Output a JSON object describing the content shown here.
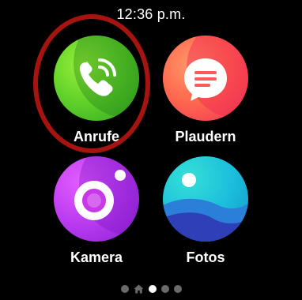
{
  "status": {
    "time": "12:36 p.m."
  },
  "apps": [
    {
      "label": "Anrufe",
      "icon": "phone-icon"
    },
    {
      "label": "Plaudern",
      "icon": "chat-icon"
    },
    {
      "label": "Kamera",
      "icon": "camera-icon"
    },
    {
      "label": "Fotos",
      "icon": "photos-icon"
    }
  ],
  "pager": {
    "page_count": 5,
    "active_page": 3,
    "home_page": 2
  },
  "colors": {
    "background": "#000000",
    "highlight_ring": "#a5140f",
    "pager_inactive": "#6a6a6a",
    "pager_active": "#ffffff"
  }
}
